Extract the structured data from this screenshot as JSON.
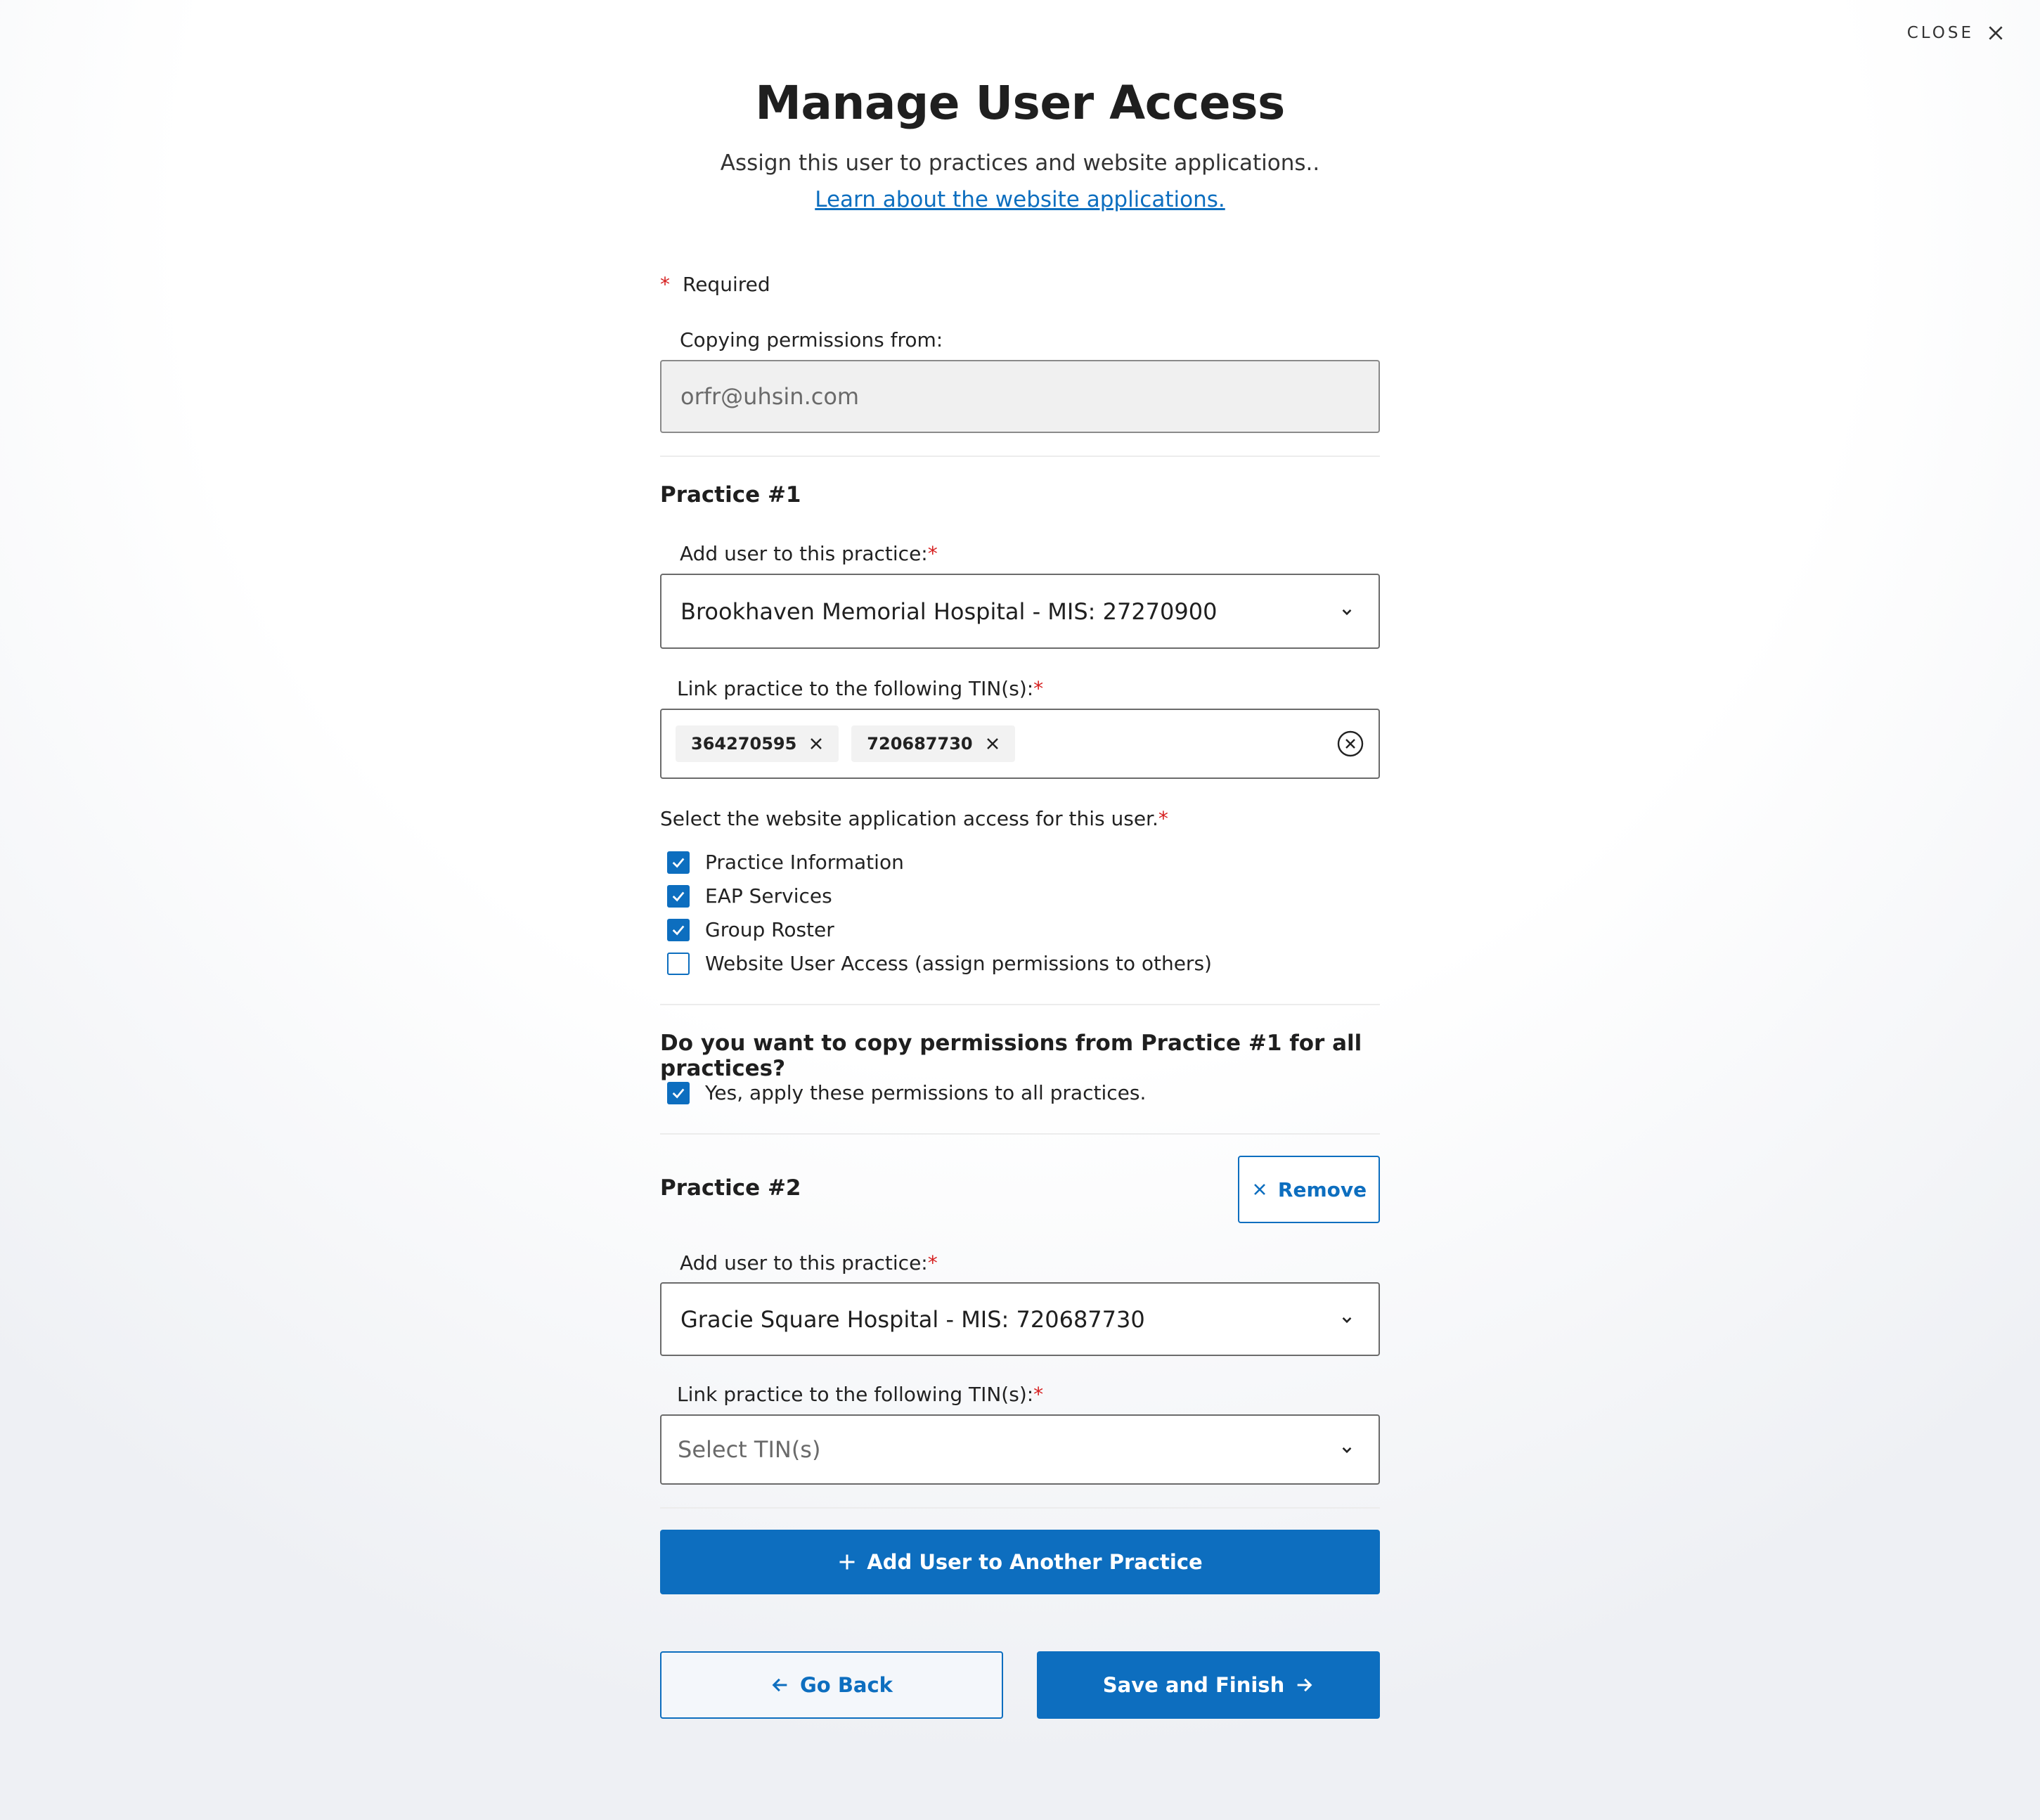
{
  "header": {
    "close_label": "CLOSE",
    "title": "Manage User Access",
    "subtitle": "Assign this user to practices and website applications..",
    "learn_link": "Learn about the website applications."
  },
  "form": {
    "required_label": "Required",
    "copying_label": "Copying permissions from:",
    "copying_value": "orfr@uhsin.com",
    "practice1": {
      "heading": "Practice #1",
      "add_label": "Add user to this practice:",
      "practice_value": "Brookhaven Memorial Hospital - MIS: 27270900",
      "tin_label": "Link practice to the following TIN(s):",
      "tins": [
        "364270595",
        "720687730"
      ],
      "access_label": "Select the website application access for this user.",
      "access": [
        {
          "label": "Practice Information",
          "checked": true
        },
        {
          "label": "EAP Services",
          "checked": true
        },
        {
          "label": "Group Roster",
          "checked": true
        },
        {
          "label": "Website User Access (assign permissions to others)",
          "checked": false
        }
      ]
    },
    "copy_question": "Do you want to copy permissions from Practice #1 for all practices?",
    "copy_option": "Yes, apply these permissions to all practices.",
    "practice2": {
      "heading": "Practice #2",
      "remove_label": "Remove",
      "add_label": "Add user to this practice:",
      "practice_value": "Gracie Square Hospital - MIS: 720687730",
      "tin_label": "Link practice to the following TIN(s):",
      "tin_placeholder": "Select TIN(s)"
    },
    "add_another_label": "Add User to Another Practice",
    "go_back_label": "Go Back",
    "save_label": "Save and Finish"
  },
  "colors": {
    "accent": "#0d6ebf",
    "required": "#d62020"
  }
}
